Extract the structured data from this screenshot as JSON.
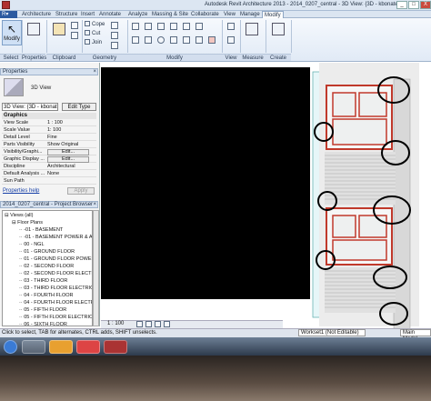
{
  "window": {
    "title": "Autodesk Revit Architecture 2013  -  2014_0207_central - 3D View: {3D - kbonate}",
    "minimize": "_",
    "maximize": "□",
    "close": "X"
  },
  "tabs": [
    "Architecture",
    "Structure",
    "Insert",
    "Annotate",
    "Analyze",
    "Massing & Site",
    "Collaborate",
    "View",
    "Manage",
    "Modify"
  ],
  "active_tab": "Modify",
  "ribbon": {
    "select": {
      "modify": "Modify",
      "group": "Select"
    },
    "properties": {
      "label": "Properties",
      "group": "Properties"
    },
    "clipboard": {
      "group": "Clipboard"
    },
    "geometry": {
      "cope": "Cope",
      "cut": "Cut",
      "join": "Join",
      "group": "Geometry"
    },
    "modify": {
      "group": "Modify"
    },
    "view": {
      "group": "View"
    },
    "measure": {
      "group": "Measure"
    },
    "create": {
      "group": "Create"
    }
  },
  "properties_panel": {
    "title": "Properties",
    "type_name": "3D View",
    "type_selector": "3D View: {3D - kbonate}",
    "edit_type": "Edit Type",
    "section": "Graphics",
    "rows": [
      {
        "key": "View Scale",
        "value": "1 : 100"
      },
      {
        "key": "Scale Value",
        "value": "1: 100"
      },
      {
        "key": "Detail Level",
        "value": "Fine"
      },
      {
        "key": "Parts Visibility",
        "value": "Show Original"
      },
      {
        "key": "Visibility/Graphi...",
        "button": "Edit..."
      },
      {
        "key": "Graphic Display ...",
        "button": "Edit..."
      },
      {
        "key": "Discipline",
        "value": "Architectural"
      },
      {
        "key": "Default Analysis ...",
        "value": "None"
      },
      {
        "key": "Sun Path",
        "value": ""
      }
    ],
    "help_link": "Properties help",
    "apply": "Apply"
  },
  "project_browser": {
    "title": "2014_0207_central - Project Browser",
    "items": [
      {
        "label": "Views (all)",
        "level": 0
      },
      {
        "label": "Floor Plans",
        "level": 1
      },
      {
        "label": "-01 - BASEMENT",
        "level": 2
      },
      {
        "label": "-01 - BASEMENT POWER & A",
        "level": 2
      },
      {
        "label": "00 - NGL",
        "level": 2
      },
      {
        "label": "01 - GROUND FLOOR",
        "level": 2
      },
      {
        "label": "01 - GROUND FLOOR POWEF",
        "level": 2
      },
      {
        "label": "02 - SECOND FLOOR",
        "level": 2
      },
      {
        "label": "02 - SECOND FLOOR ELECTR",
        "level": 2
      },
      {
        "label": "03 - THIRD FLOOR",
        "level": 2
      },
      {
        "label": "03 - THIRD FLOOR ELECTRICA",
        "level": 2
      },
      {
        "label": "04 - FOURTH FLOOR",
        "level": 2
      },
      {
        "label": "04 - FOURTH FLOOR ELECTR",
        "level": 2
      },
      {
        "label": "05 - FIFTH FLOOR",
        "level": 2
      },
      {
        "label": "05 - FIFTH FLOOR ELECTRICA",
        "level": 2
      },
      {
        "label": "06 - SIXTH FLOOR",
        "level": 2
      }
    ]
  },
  "view_control": {
    "scale": "1 : 100"
  },
  "status": {
    "text": "Click to select, TAB for alternates, CTRL adds, SHIFT unselects.",
    "workset": "Workset1 (Not Editable)",
    "model": "Main Model"
  },
  "colors": {
    "frame_red": "#c0392b",
    "annotation_circle": "#000000",
    "viewport_bg": "#ffffff",
    "black_void": "#000000"
  }
}
